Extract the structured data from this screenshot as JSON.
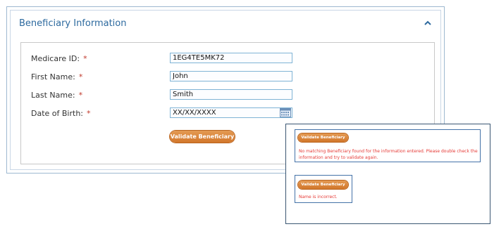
{
  "section": {
    "title": "Beneficiary Information",
    "collapse_icon": "chevron-up-icon"
  },
  "form": {
    "fields": [
      {
        "label": "Medicare ID:",
        "required_mark": "*",
        "value": "1EG4TE5MK72"
      },
      {
        "label": "First Name:",
        "required_mark": "*",
        "value": "John"
      },
      {
        "label": "Last Name:",
        "required_mark": "*",
        "value": "Smith"
      },
      {
        "label": "Date of Birth:",
        "required_mark": "*",
        "value": "XX/XX/XXXX"
      }
    ],
    "calendar_icon": "calendar-icon",
    "validate_label": "Validate Beneficiary"
  },
  "popup": {
    "message1": {
      "button_label": "Validate Beneficiary",
      "error_text": "No matching Beneficiary found for the information entered. Please double check the information and try to validate again."
    },
    "message2": {
      "button_label": "Validate Beneficiary",
      "error_text": "Name is incorrect."
    }
  },
  "colors": {
    "accent": "#2d6a9f",
    "button": "#dd8a3f",
    "error": "#e53935",
    "required": "#c0392b"
  }
}
